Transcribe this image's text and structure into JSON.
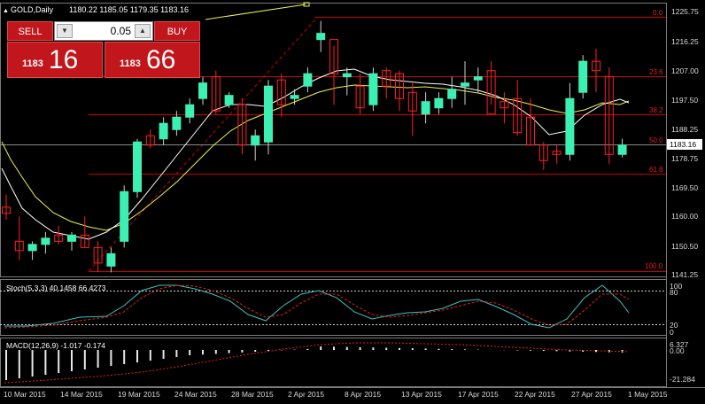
{
  "header": {
    "symbol_label": "GOLD,Daily",
    "ohlc": "1180.22 1185.05 1179.35 1183.16",
    "menu_arrow": "▲"
  },
  "trade_panel": {
    "sell_label": "SELL",
    "buy_label": "BUY",
    "lot_value": "0.05",
    "sell_big_figure": "1183",
    "sell_pips": "16",
    "buy_big_figure": "1183",
    "buy_pips": "66",
    "down_arrow": "▼",
    "up_arrow": "▲"
  },
  "price_scale": {
    "labels": [
      "1225.75",
      "1216.25",
      "1207.00",
      "1197.50",
      "1188.25",
      "1178.75",
      "1169.50",
      "1160.00",
      "1150.50",
      "1141.25"
    ],
    "current_price": "1183.16"
  },
  "fibonacci": {
    "levels": [
      "0.0",
      "23.6",
      "38.2",
      "50.0",
      "61.8",
      "100.0"
    ]
  },
  "stochastic": {
    "label": "Stoch(5,3,3) 40.1458 66.4273",
    "scale": [
      "100",
      "80",
      "20",
      "0"
    ]
  },
  "macd": {
    "label": "MACD(12,26,9) -1.017 -0.174",
    "scale": [
      "6.327",
      "0.00",
      "-21.284"
    ]
  },
  "time_axis": {
    "labels": [
      "10 Mar 2015",
      "14 Mar 2015",
      "19 Mar 2015",
      "24 Mar 2015",
      "28 Mar 2015",
      "2 Apr 2015",
      "8 Apr 2015",
      "13 Apr 2015",
      "17 Apr 2015",
      "22 Apr 2015",
      "27 Apr 2015",
      "1 May 2015"
    ]
  },
  "colors": {
    "bull": "#3cf0b4",
    "bear": "#ff2020",
    "grid_line": "#c00000",
    "ma_fast": "#ffffff",
    "ma_slow": "#ffff50",
    "panel_red": "#c1161b"
  },
  "chart_data": {
    "type": "candlestick",
    "series": [
      {
        "name": "GOLD,Daily",
        "ohlc": [
          [
            1163,
            1167,
            1159,
            1161
          ],
          [
            1152,
            1160,
            1146,
            1149
          ],
          [
            1149,
            1152,
            1146,
            1151
          ],
          [
            1151,
            1155,
            1148,
            1153
          ],
          [
            1154,
            1157,
            1151,
            1152
          ],
          [
            1152,
            1155,
            1149,
            1154
          ],
          [
            1154,
            1160,
            1150,
            1150
          ],
          [
            1150,
            1152,
            1142,
            1145
          ],
          [
            1144,
            1150,
            1142,
            1148
          ],
          [
            1152,
            1170,
            1150,
            1168
          ],
          [
            1168,
            1185,
            1166,
            1184
          ],
          [
            1186,
            1188,
            1182,
            1183
          ],
          [
            1185,
            1192,
            1183,
            1190
          ],
          [
            1188,
            1194,
            1186,
            1192
          ],
          [
            1192,
            1198,
            1190,
            1196
          ],
          [
            1198,
            1205,
            1196,
            1203
          ],
          [
            1205,
            1207,
            1193,
            1194
          ],
          [
            1196,
            1200,
            1195,
            1199
          ],
          [
            1196,
            1198,
            1180,
            1183
          ],
          [
            1183,
            1188,
            1178,
            1186
          ],
          [
            1184,
            1204,
            1180,
            1202
          ],
          [
            1204,
            1206,
            1192,
            1196
          ],
          [
            1198,
            1201,
            1196,
            1199
          ],
          [
            1202,
            1208,
            1200,
            1206
          ],
          [
            1217,
            1223,
            1213,
            1219
          ],
          [
            1217,
            1215,
            1196,
            1206
          ],
          [
            1205,
            1208,
            1199,
            1206
          ],
          [
            1202,
            1206,
            1193,
            1195
          ],
          [
            1196,
            1208,
            1194,
            1206
          ],
          [
            1207,
            1208,
            1198,
            1202
          ],
          [
            1206,
            1207,
            1194,
            1198
          ],
          [
            1200,
            1203,
            1186,
            1194
          ],
          [
            1193,
            1200,
            1190,
            1197
          ],
          [
            1195,
            1200,
            1193,
            1198
          ],
          [
            1198,
            1205,
            1195,
            1201
          ],
          [
            1202,
            1210,
            1196,
            1203
          ],
          [
            1204,
            1208,
            1200,
            1205
          ],
          [
            1207,
            1210,
            1196,
            1193
          ],
          [
            1197,
            1200,
            1190,
            1195
          ],
          [
            1198,
            1204,
            1186,
            1187
          ],
          [
            1192,
            1198,
            1183,
            1183
          ],
          [
            1183,
            1184,
            1175,
            1178
          ],
          [
            1181,
            1183,
            1177,
            1180
          ],
          [
            1180,
            1203,
            1178,
            1198
          ],
          [
            1200,
            1212,
            1198,
            1210
          ],
          [
            1210,
            1214,
            1200,
            1207
          ],
          [
            1205,
            1208,
            1177,
            1180
          ],
          [
            1180,
            1185,
            1179,
            1183
          ]
        ]
      }
    ]
  }
}
